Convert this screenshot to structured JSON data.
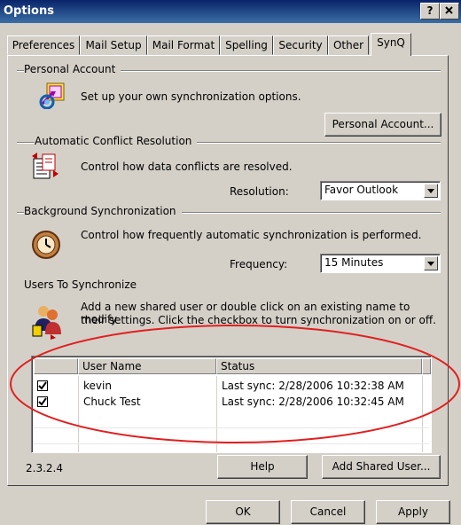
{
  "window": {
    "title": "Options",
    "help_glyph": "?",
    "close_glyph": "X"
  },
  "tabs": [
    "Preferences",
    "Mail Setup",
    "Mail Format",
    "Spelling",
    "Security",
    "Other",
    "SynQ"
  ],
  "active_tab": "SynQ",
  "personal_account": {
    "group_label": "Personal Account",
    "description": "Set up your own synchronization options.",
    "button_label": "Personal Account..."
  },
  "conflict": {
    "group_label": "Automatic Conflict Resolution",
    "description": "Control how data conflicts are resolved.",
    "resolution_label": "Resolution:",
    "resolution_value": "Favor Outlook"
  },
  "background": {
    "group_label": "Background Synchronization",
    "description": "Control how frequently automatic synchronization is performed.",
    "frequency_label": "Frequency:",
    "frequency_value": "15 Minutes"
  },
  "users": {
    "group_label": "Users To Synchronize",
    "description_line1": "Add a new shared user or double click on an existing name to modify",
    "description_line2": "their settings. Click the checkbox to turn synchronization on or off.",
    "columns": [
      "User Name",
      "Status"
    ],
    "rows": [
      {
        "checked": true,
        "name": "kevin",
        "status": "Last sync: 2/28/2006 10:32:38 AM"
      },
      {
        "checked": true,
        "name": "Chuck Test",
        "status": "Last sync: 2/28/2006 10:32:45 AM"
      }
    ]
  },
  "version": "2.3.2.4",
  "help_button": "Help",
  "add_shared_user_button": "Add Shared User...",
  "footer": {
    "ok": "OK",
    "cancel": "Cancel",
    "apply": "Apply"
  },
  "colors": {
    "titlebar": "#0a246a",
    "dialog": "#d4d0c8",
    "annotation": "#e02020"
  }
}
